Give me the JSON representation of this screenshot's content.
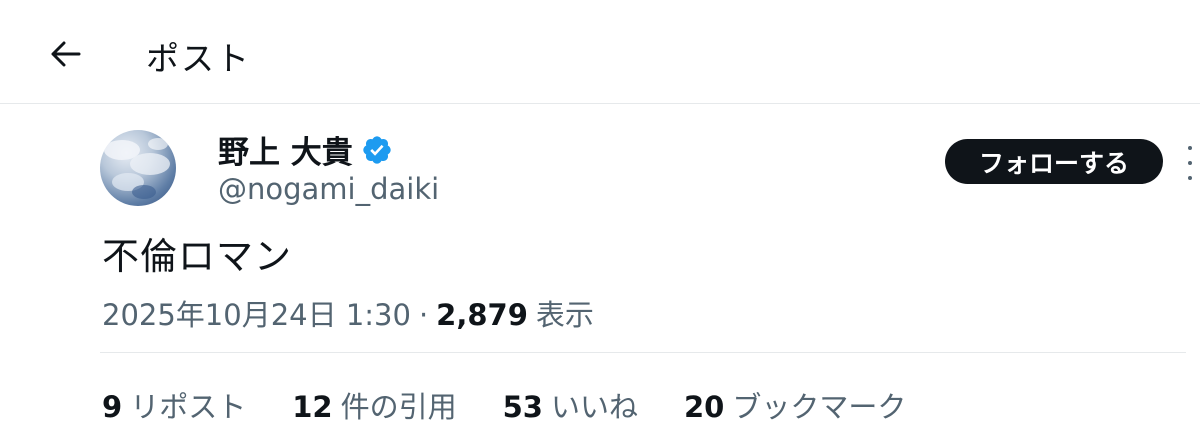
{
  "header": {
    "title": "ポスト",
    "back_icon": "arrow-left-icon"
  },
  "author": {
    "display_name": "野上 大貴",
    "handle": "@nogami_daiki",
    "verified_icon": "verified-badge-icon",
    "verified_color": "#1d9bf0"
  },
  "follow_label": "フォローする",
  "tweet": {
    "text": "不倫ロマン"
  },
  "meta": {
    "timestamp": "2025年10月24日 1:30",
    "separator": "·",
    "views_count": "2,879",
    "views_label": "表示"
  },
  "stats": [
    {
      "count": "9",
      "label": "リポスト"
    },
    {
      "count": "12",
      "label": "件の引用"
    },
    {
      "count": "53",
      "label": "いいね"
    },
    {
      "count": "20",
      "label": "ブックマーク"
    }
  ],
  "colors": {
    "text": "#0f1419",
    "secondary": "#536471",
    "border": "#e6e9eb",
    "button_bg": "#0f1419"
  }
}
